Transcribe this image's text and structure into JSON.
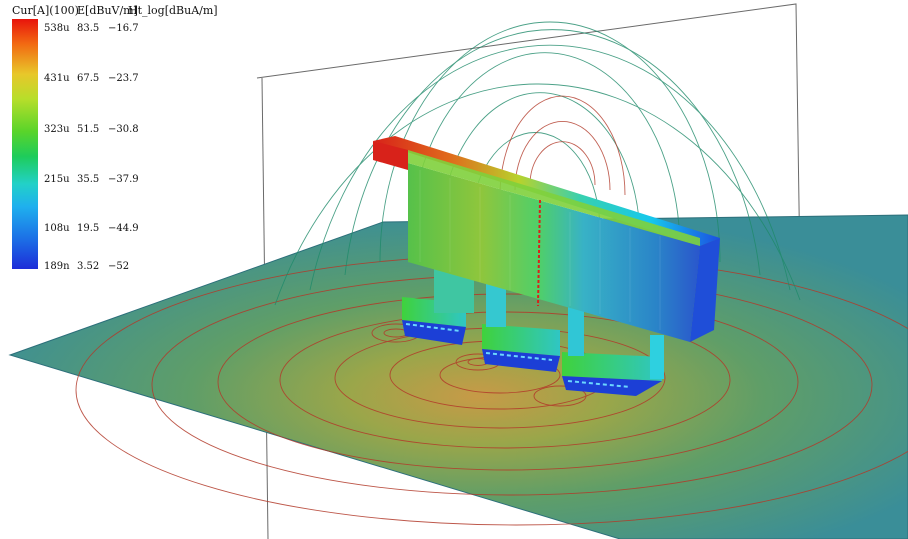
{
  "legend": {
    "headers": [
      "Cur[A](100)",
      "E[dBuV/m]",
      "Ht_log[dBuA/m]"
    ],
    "rows": [
      {
        "cur": "538u",
        "e": "83.5",
        "h": "−16.7"
      },
      {
        "cur": "431u",
        "e": "67.5",
        "h": "−23.7"
      },
      {
        "cur": "323u",
        "e": "51.5",
        "h": "−30.8"
      },
      {
        "cur": "215u",
        "e": "35.5",
        "h": "−37.9"
      },
      {
        "cur": "108u",
        "e": "19.5",
        "h": "−44.9"
      },
      {
        "cur": "189n",
        "e": "3.52",
        "h": "−52"
      }
    ]
  },
  "colors": {
    "scale": [
      "#e8140c",
      "#f26a12",
      "#e8c72a",
      "#b7de2a",
      "#59d42a",
      "#1ecc5b",
      "#22d1c8",
      "#1fb0ee",
      "#1c6fe6",
      "#1d2dd8"
    ],
    "plane": "#3f9a96",
    "contour_red": "#b23a2a",
    "contour_green": "#1f8a6a",
    "wall_outline": "#6a6a6a",
    "busbar_top": "#d8221a"
  }
}
